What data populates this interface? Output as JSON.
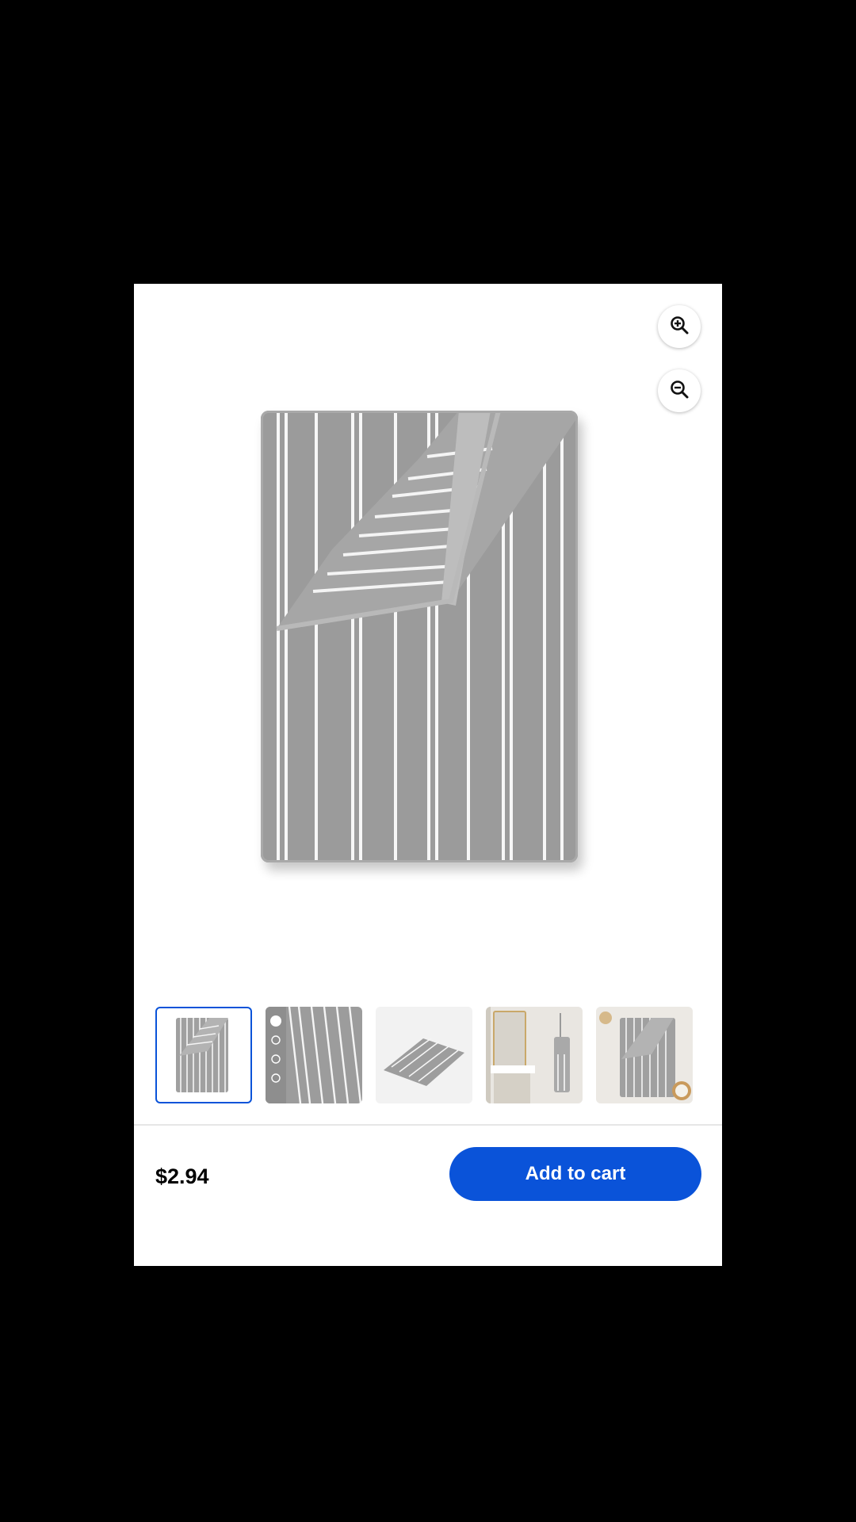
{
  "viewer": {
    "zoom_in_icon": "zoom-in-icon",
    "zoom_out_icon": "zoom-out-icon",
    "main_image": "gray-white-striped-towel"
  },
  "thumbnails": [
    {
      "image": "striped-towel-folded-corner",
      "selected": true
    },
    {
      "image": "striped-towel-closeup-features",
      "selected": false
    },
    {
      "image": "striped-towel-folded-angle",
      "selected": false
    },
    {
      "image": "bathroom-scene-hanging-towel",
      "selected": false
    },
    {
      "image": "striped-towel-lifestyle",
      "selected": false
    }
  ],
  "footer": {
    "price": "$2.94",
    "add_to_cart_label": "Add to cart"
  },
  "colors": {
    "accent": "#0a53d9",
    "towel_gray": "#9d9d9d"
  }
}
